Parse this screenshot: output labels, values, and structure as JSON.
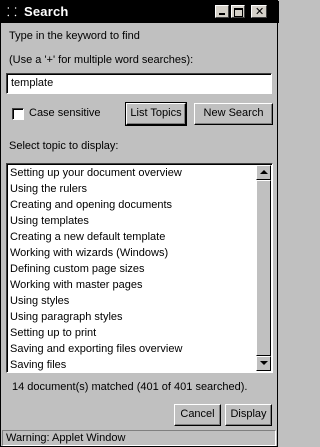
{
  "window": {
    "title": "Search",
    "system_icon": "applet-menu-icon",
    "minimize_icon": "minimize-icon",
    "maximize_icon": "maximize-icon",
    "close_glyph": "✕"
  },
  "instructions": {
    "line1": "Type in the keyword to find",
    "line2": "(Use a '+' for multiple word searches):"
  },
  "search": {
    "value": "template"
  },
  "options": {
    "case_sensitive_label": "Case sensitive",
    "case_sensitive_checked": false
  },
  "buttons": {
    "list_topics": "List Topics",
    "new_search": "New Search",
    "cancel": "Cancel",
    "display": "Display"
  },
  "topics": {
    "label": "Select topic to display:",
    "items": [
      "Setting up your document overview",
      "Using the rulers",
      "Creating and opening documents",
      "Using templates",
      "Creating a new default template",
      "Working with wizards (Windows)",
      "Defining custom page sizes",
      "Working with master pages",
      "Using styles",
      "Using paragraph styles",
      "Setting up to print",
      "Saving and exporting files overview",
      "Saving files"
    ]
  },
  "result": {
    "summary": "14 document(s) matched (401 of 401 searched)."
  },
  "status": {
    "warning": "Warning: Applet Window"
  }
}
